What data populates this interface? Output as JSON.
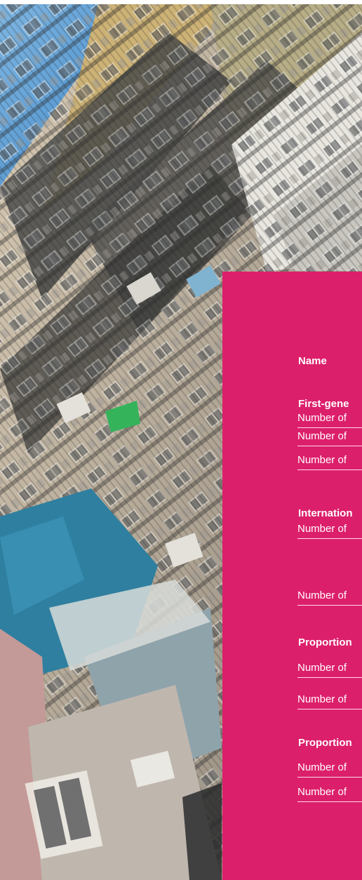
{
  "table": {
    "name_header": "Name",
    "sections": [
      {
        "title": "First-gene",
        "rows": [
          "Number of",
          "Number of",
          "Number of"
        ]
      },
      {
        "title": "Internation",
        "rows": [
          "Number of",
          "Number of"
        ]
      },
      {
        "title": "Proportion",
        "rows": [
          "Number of",
          "Number of"
        ]
      },
      {
        "title": "Proportion",
        "rows": [
          "Number of",
          "Number of"
        ]
      }
    ]
  },
  "colors": {
    "panel": "#dc1f6b",
    "sky": "#5a9fd4",
    "text": "#ffffff"
  }
}
